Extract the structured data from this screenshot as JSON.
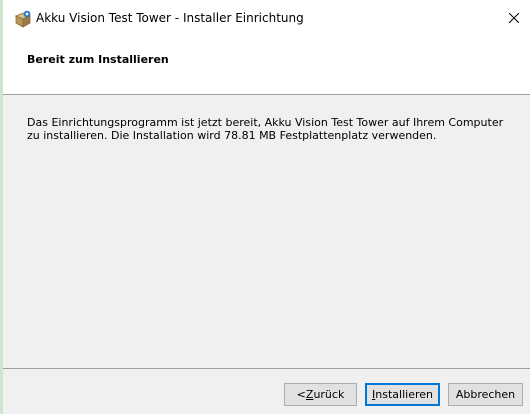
{
  "window": {
    "title": "Akku Vision Test Tower - Installer Einrichtung",
    "close_glyph": "✕",
    "app_icon": "installer-box-icon"
  },
  "banner": {
    "title": "Bereit zum Installieren"
  },
  "main": {
    "message": "Das Einrichtungsprogramm ist jetzt bereit, Akku Vision Test Tower auf Ihrem Computer zu installieren. Die Installation wird 78.81 MB Festplattenplatz verwenden."
  },
  "buttons": {
    "back": {
      "prefix": "< ",
      "mnemonic": "Z",
      "rest": "urück"
    },
    "install": {
      "mnemonic": "I",
      "rest": "nstallieren"
    },
    "cancel": {
      "label": "Abbrechen"
    }
  },
  "colors": {
    "accent": "#0078d7",
    "banner_bg": "#ffffff",
    "dialog_bg": "#f0f0f0"
  }
}
